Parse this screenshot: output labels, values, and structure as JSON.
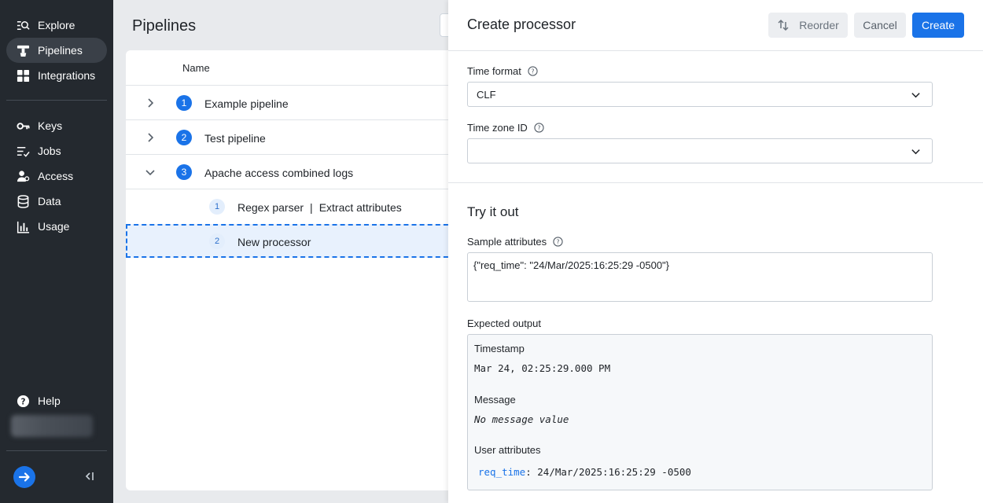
{
  "sidebar": {
    "items": [
      {
        "label": "Explore",
        "icon": "explore-icon"
      },
      {
        "label": "Pipelines",
        "icon": "pipelines-icon",
        "active": true
      },
      {
        "label": "Integrations",
        "icon": "integrations-icon"
      },
      {
        "label": "Keys",
        "icon": "key-icon"
      },
      {
        "label": "Jobs",
        "icon": "jobs-icon"
      },
      {
        "label": "Access",
        "icon": "access-icon"
      },
      {
        "label": "Data",
        "icon": "database-icon"
      },
      {
        "label": "Usage",
        "icon": "usage-chart-icon"
      }
    ],
    "help_label": "Help"
  },
  "main": {
    "title": "Pipelines",
    "table": {
      "column_header": "Name",
      "rows": [
        {
          "number": "1",
          "label": "Example pipeline",
          "expanded": false
        },
        {
          "number": "2",
          "label": "Test pipeline",
          "expanded": false
        },
        {
          "number": "3",
          "label": "Apache access combined logs",
          "expanded": true
        }
      ],
      "processors": [
        {
          "number": "1",
          "name": "Regex parser",
          "separator": "|",
          "detail": "Extract attributes"
        },
        {
          "number": "2",
          "name": "New processor"
        }
      ]
    }
  },
  "panel": {
    "title": "Create processor",
    "buttons": {
      "reorder": "Reorder",
      "cancel": "Cancel",
      "create": "Create"
    },
    "time_format": {
      "label": "Time format",
      "value": "CLF"
    },
    "time_zone": {
      "label": "Time zone ID",
      "value": ""
    },
    "try_it_out": {
      "title": "Try it out",
      "sample_label": "Sample attributes",
      "sample_value": "{\"req_time\": \"24/Mar/2025:16:25:29 -0500\"}",
      "expected_label": "Expected output",
      "output": {
        "timestamp_label": "Timestamp",
        "timestamp_value": "Mar 24, 02:25:29.000 PM",
        "message_label": "Message",
        "message_value": "No message value",
        "user_attributes_label": "User attributes",
        "attr_key": "req_time",
        "attr_value": ": 24/Mar/2025:16:25:29 -0500"
      }
    }
  }
}
